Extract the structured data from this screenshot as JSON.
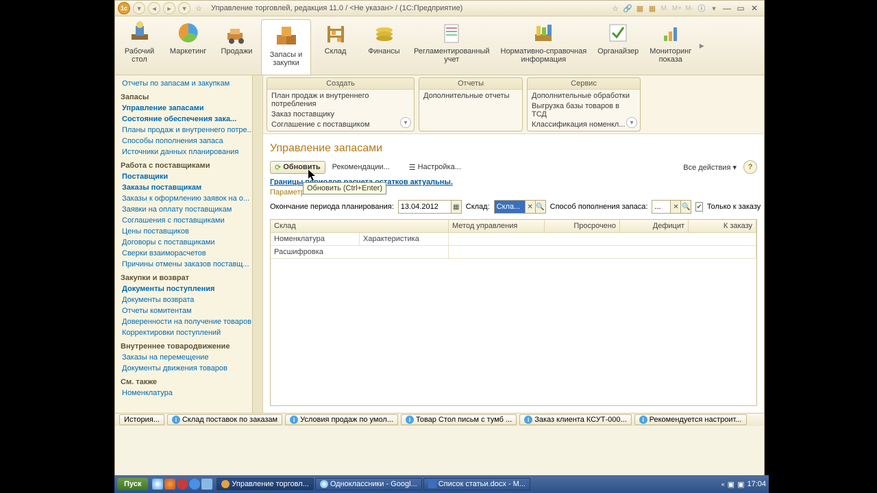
{
  "title": "Управление торговлей, редакция 11.0 / <Не указан> / (1С:Предприятие)",
  "ribbon": [
    {
      "l1": "Рабочий",
      "l2": "стол"
    },
    {
      "l1": "Маркетинг"
    },
    {
      "l1": "Продажи"
    },
    {
      "l1": "Запасы и",
      "l2": "закупки"
    },
    {
      "l1": "Склад"
    },
    {
      "l1": "Финансы"
    },
    {
      "l1": "Регламентированный",
      "l2": "учет"
    },
    {
      "l1": "Нормативно-справочная",
      "l2": "информация"
    },
    {
      "l1": "Органайзер"
    },
    {
      "l1": "Мониторинг",
      "l2": "показа"
    }
  ],
  "side": {
    "top": "Отчеты по запасам и закупкам",
    "g1": {
      "h": "Запасы",
      "i": [
        "Управление запасами",
        "Состояние обеспечения зака...",
        "Планы продаж и внутреннего потре...",
        "Способы пополнения запаса",
        "Источники данных планирования"
      ]
    },
    "g2": {
      "h": "Работа с поставщиками",
      "i": [
        "Поставщики",
        "Заказы поставщикам",
        "Заказы к оформлению заявок на о...",
        "Заявки на оплату поставщикам",
        "Соглашения с поставщиками",
        "Цены поставщиков",
        "Договоры с поставщиками",
        "Сверки взаиморасчетов",
        "Причины отмены заказов поставщ..."
      ]
    },
    "g3": {
      "h": "Закупки и возврат",
      "i": [
        "Документы поступления",
        "Документы возврата",
        "Отчеты комитентам",
        "Доверенности на получение товаров",
        "Корректировки поступлений"
      ]
    },
    "g4": {
      "h": "Внутреннее товародвижение",
      "i": [
        "Заказы на перемещение",
        "Документы движения товаров"
      ]
    },
    "g5": {
      "h": "См. также",
      "i": [
        "Номенклатура"
      ]
    }
  },
  "sub": {
    "create": {
      "h": "Создать",
      "i": [
        "План продаж и внутреннего потребления",
        "Заказ поставщику",
        "Соглашение с поставщиком"
      ]
    },
    "reports": {
      "h": "Отчеты",
      "i": [
        "Дополнительные отчеты"
      ]
    },
    "service": {
      "h": "Сервис",
      "i": [
        "Дополнительные обработки",
        "Выгрузка базы товаров в ТСД",
        "Классификация номенкл..."
      ]
    }
  },
  "main": {
    "title": "Управление запасами",
    "refresh": "Обновить",
    "recom": "Рекомендации...",
    "setting": "Настройка...",
    "allact": "Все действия ▾",
    "infolink": "Границы периодов расчета остатков актуальны.",
    "params": "Параметры",
    "planend": "Окончание периода планирования:",
    "date": "13.04.2012",
    "wh": "Склад:",
    "whval": "Скла...",
    "repl": "Способ пополнения запаса:",
    "replval": "...",
    "only": "Только к заказу"
  },
  "grid": {
    "c": [
      "Склад",
      "Метод управления",
      "Просрочено",
      "Дефицит",
      "К заказу"
    ],
    "c2": [
      "Номенклатура",
      "Характеристика"
    ],
    "c3": [
      "Расшифровка"
    ]
  },
  "tooltip": "Обновить (Ctrl+Enter)",
  "status": [
    "История...",
    "Склад поставок по заказам",
    "Условия продаж по умол...",
    "Товар Стол письм с тумб ...",
    "Заказ клиента КСУТ-000...",
    "Рекомендуется настроит..."
  ],
  "task": {
    "start": "Пуск",
    "items": [
      "Управление торговл...",
      "Одноклассники - Googl...",
      "Список статьи.docx - M..."
    ],
    "time": "17:04"
  }
}
